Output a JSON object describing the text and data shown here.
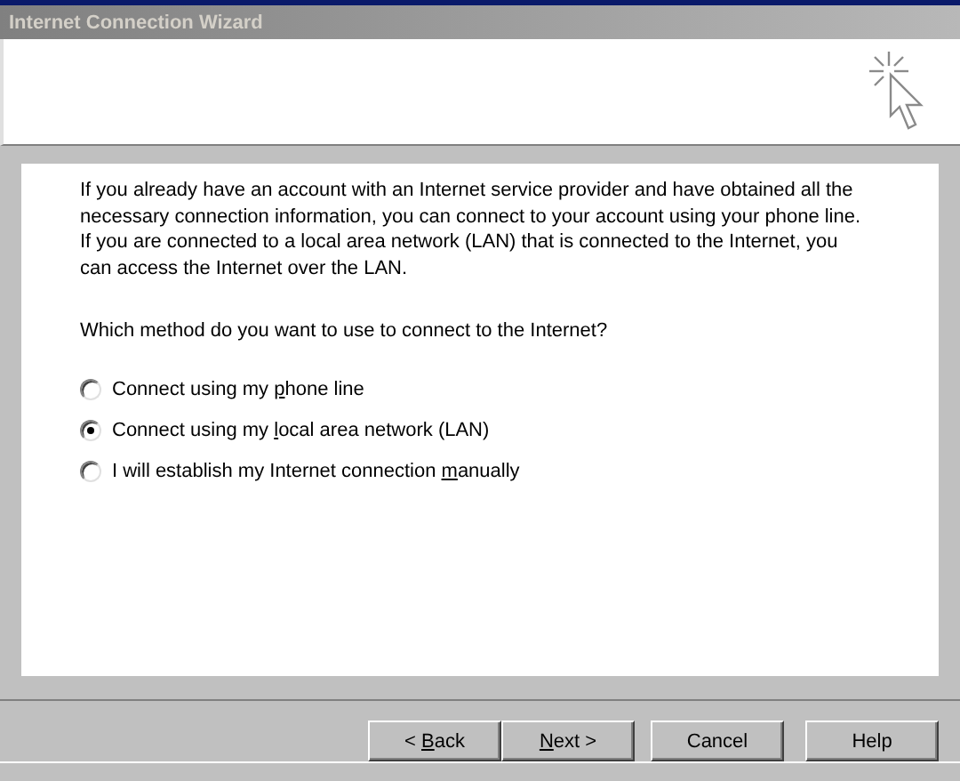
{
  "window": {
    "title": "Internet Connection Wizard"
  },
  "intro": "If you already have an account with an Internet service provider and have obtained all the necessary connection information, you can connect to your account using your phone line. If you are connected to a local area network (LAN) that is connected to the Internet, you can access the Internet over the LAN.",
  "question": "Which method do you want to use to connect to the Internet?",
  "options": [
    {
      "before": "Connect using my ",
      "key": "p",
      "after": "hone line",
      "selected": false
    },
    {
      "before": "Connect using my ",
      "key": "l",
      "after": "ocal area network (LAN)",
      "selected": true
    },
    {
      "before": "I will establish my Internet connection ",
      "key": "m",
      "after": "anually",
      "selected": false
    }
  ],
  "buttons": [
    {
      "before": "< ",
      "key": "B",
      "after": "ack",
      "kind": "back"
    },
    {
      "key": "N",
      "after": "ext >",
      "kind": "next"
    },
    {
      "before": "Cancel",
      "kind": "cancel"
    },
    {
      "before": "Help",
      "kind": "help"
    }
  ]
}
